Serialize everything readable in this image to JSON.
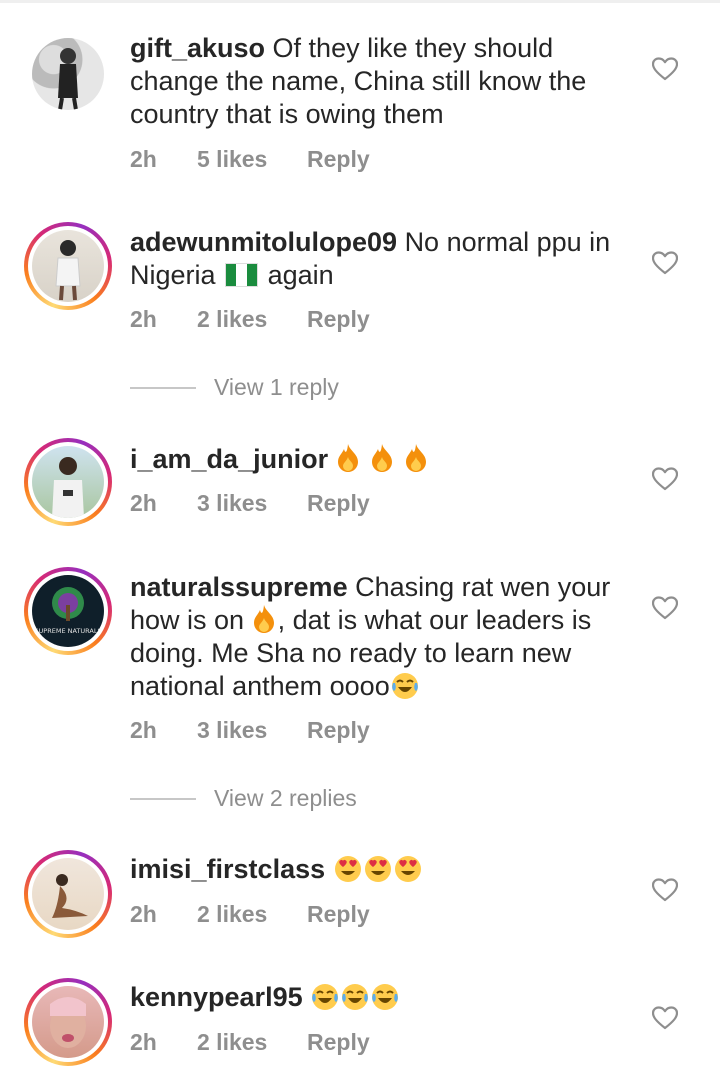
{
  "comments": [
    {
      "username": "gift_akuso",
      "text": "Of they like they should change the name, China still know the country that is owing them",
      "time": "2h",
      "likes": "5 likes",
      "reply": "Reply"
    },
    {
      "username": "adewunmitolulope09",
      "text_before": "No normal ppu in Nigeria",
      "text_after": "again",
      "time": "2h",
      "likes": "2 likes",
      "reply": "Reply",
      "view_replies": "View 1 reply"
    },
    {
      "username": "i_am_da_junior",
      "emojis": [
        "fire",
        "fire",
        "fire"
      ],
      "time": "2h",
      "likes": "3 likes",
      "reply": "Reply"
    },
    {
      "username": "naturalssupreme",
      "text_before": "Chasing rat wen your how is on",
      "text_after": ", dat is what our leaders is doing. Me Sha no ready to learn new national anthem oooo",
      "time": "2h",
      "likes": "3 likes",
      "reply": "Reply",
      "view_replies": "View 2 replies",
      "avatar_text": "SUPREME NATURALS"
    },
    {
      "username": "imisi_firstclass",
      "emojis": [
        "heart-eyes",
        "heart-eyes",
        "heart-eyes"
      ],
      "time": "2h",
      "likes": "2 likes",
      "reply": "Reply"
    },
    {
      "username": "kennypearl95",
      "emojis": [
        "tears-of-joy",
        "tears-of-joy",
        "tears-of-joy"
      ],
      "time": "2h",
      "likes": "2 likes",
      "reply": "Reply"
    }
  ],
  "icons": {
    "like": "heart-outline-icon",
    "flag": "nigeria-flag-icon"
  },
  "colors": {
    "text": "#262626",
    "meta": "#8e8e8e",
    "story_ring": "#d62976"
  }
}
